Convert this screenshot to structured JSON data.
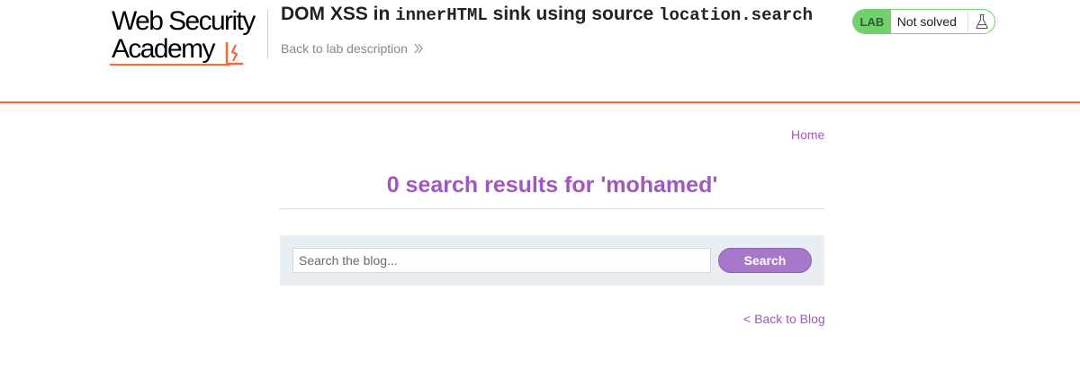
{
  "header": {
    "logo": {
      "line1": "Web Security",
      "line2": "Academy"
    },
    "title_prefix": "DOM XSS in ",
    "title_code1": "innerHTML",
    "title_mid": " sink using source ",
    "title_code2": "location.search",
    "back_to_description": "Back to lab description",
    "lab_badge": {
      "label": "LAB",
      "status": "Not solved",
      "icon": "flask-icon"
    }
  },
  "nav": {
    "home": "Home"
  },
  "search": {
    "results_text": "0 search results for 'mohamed'",
    "placeholder": "Search the blog...",
    "button_label": "Search"
  },
  "footer": {
    "back_to_blog": "< Back to Blog"
  },
  "colors": {
    "accent": "#a157bd",
    "brand_orange": "#ff6633",
    "lab_green": "#70d16d",
    "search_bg": "#e8eef1"
  }
}
